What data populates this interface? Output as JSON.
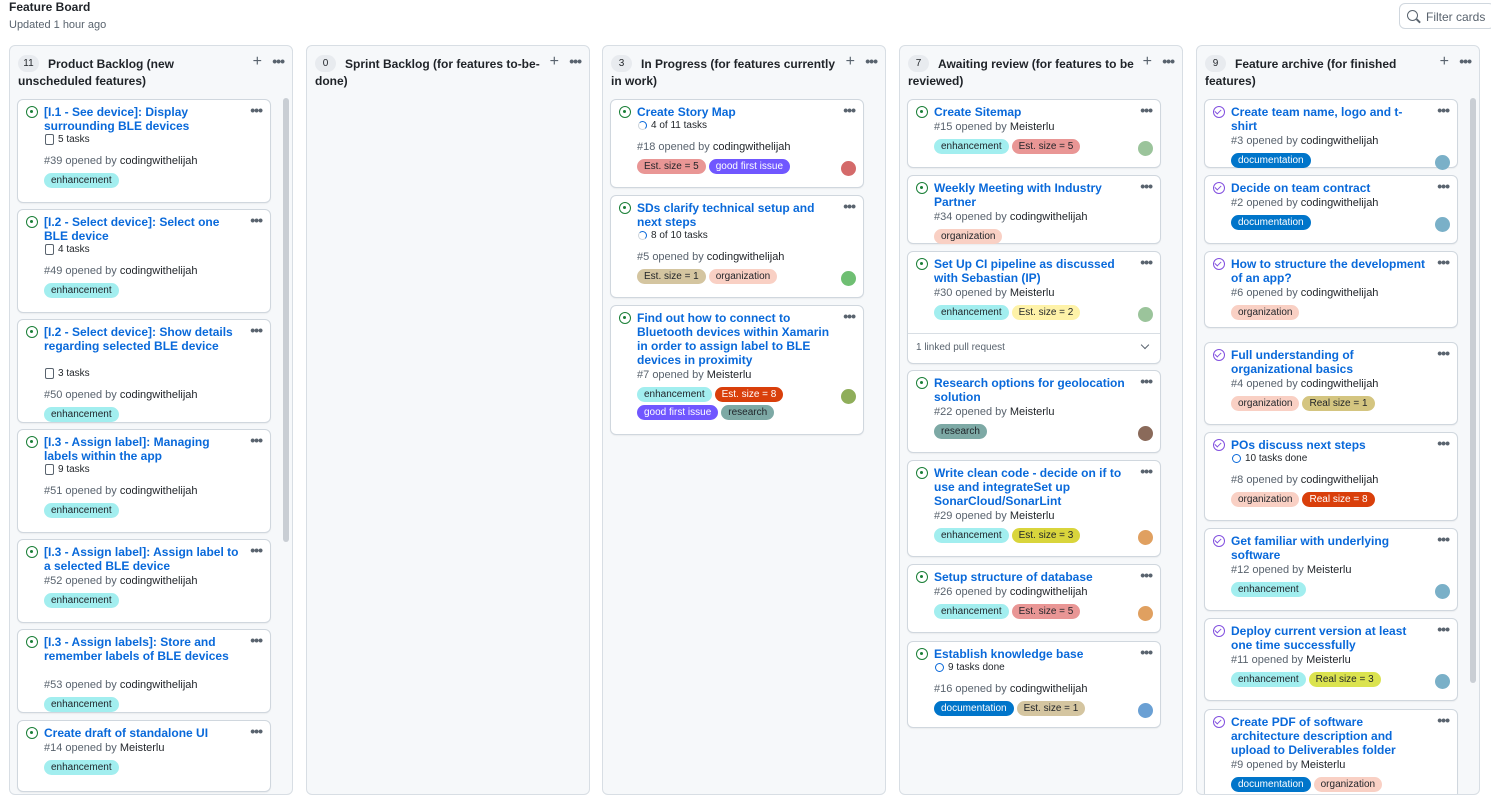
{
  "board": {
    "title": "Feature Board",
    "updated": "Updated 1 hour ago",
    "filter_placeholder": "Filter cards"
  },
  "label_colors": {
    "enhancement": "#a2eeef",
    "organization": "#f9d0c4",
    "documentation": "#0075ca",
    "research": "#7da9a5",
    "good first issue": "#7057ff",
    "Est. size = 5": "#e99695",
    "Est. size = 1": "#d4c5a0",
    "Est. size = 2": "#fef2a8",
    "Est. size = 3": "#d9d53c",
    "Est. size = 8": "#d93f0b",
    "Real size = 1": "#d4c580",
    "Real size = 3": "#dbe34f",
    "Real size = 8": "#d93f0b"
  },
  "columns": [
    {
      "count": "11",
      "title": "Product Backlog (new unscheduled features)",
      "cards": [
        {
          "title": "[I.1 - See device]: Display surrounding BLE devices",
          "tasks": "5 tasks",
          "task_icon": "checklist-icon",
          "num": "#39",
          "opened": "opened by",
          "author": "codingwithelijah",
          "labels": [
            "enhancement"
          ]
        },
        {
          "title": "[I.2 - Select device]: Select one BLE device",
          "tasks": "4 tasks",
          "task_icon": "checklist-icon",
          "num": "#49",
          "opened": "opened by",
          "author": "codingwithelijah",
          "labels": [
            "enhancement"
          ]
        },
        {
          "title": "[I.2 - Select device]: Show details regarding selected BLE device",
          "tasks": "3 tasks",
          "task_icon": "checklist-icon",
          "num": "#50",
          "opened": "opened by",
          "author": "codingwithelijah",
          "labels": [
            "enhancement"
          ]
        },
        {
          "title": "[I.3 - Assign label]: Managing labels within the app",
          "tasks": "9 tasks",
          "task_icon": "checklist-icon",
          "num": "#51",
          "opened": "opened by",
          "author": "codingwithelijah",
          "labels": [
            "enhancement"
          ]
        },
        {
          "title": "[I.3 - Assign label]: Assign label to a selected BLE device",
          "num": "#52",
          "opened": "opened by",
          "author": "codingwithelijah",
          "labels": [
            "enhancement"
          ]
        },
        {
          "title": "[I.3 - Assign labels]: Store and remember labels of BLE devices",
          "num": "#53",
          "opened": "opened by",
          "author": "codingwithelijah",
          "labels": [
            "enhancement"
          ]
        },
        {
          "title": "Create draft of standalone UI",
          "num": "#14",
          "opened": "opened by",
          "author": "Meisterlu",
          "labels": [
            "enhancement"
          ]
        }
      ]
    },
    {
      "count": "0",
      "title": "Sprint Backlog (for features to-be-done)",
      "cards": []
    },
    {
      "count": "3",
      "title": "In Progress (for features currently in work)",
      "cards": [
        {
          "title": "Create Story Map",
          "tasks": "4 of 11 tasks",
          "task_icon": "progress-icon",
          "num": "#18",
          "opened": "opened by",
          "author": "codingwithelijah",
          "labels": [
            "Est. size = 5",
            "good first issue"
          ],
          "avatar": "#d46a6a"
        },
        {
          "title": "SDs clarify technical setup and next steps",
          "tasks": "8 of 10 tasks",
          "task_icon": "progress-icon",
          "num": "#5",
          "opened": "opened by",
          "author": "codingwithelijah",
          "labels": [
            "Est. size = 1",
            "organization"
          ],
          "avatar": "#6fbf73"
        },
        {
          "title": "Find out how to connect to Bluetooth devices within Xamarin in order to assign label to BLE devices in proximity",
          "num": "#7",
          "opened": "opened by",
          "author": "Meisterlu",
          "labels": [
            "enhancement",
            "Est. size = 8",
            "good first issue",
            "research"
          ],
          "avatar": "#8fae5a"
        }
      ]
    },
    {
      "count": "7",
      "title": "Awaiting review (for features to be reviewed)",
      "cards": [
        {
          "title": "Create Sitemap",
          "num": "#15",
          "opened": "opened by",
          "author": "Meisterlu",
          "labels": [
            "enhancement",
            "Est. size = 5"
          ],
          "avatar": "#9bc49b"
        },
        {
          "title": "Weekly Meeting with Industry Partner",
          "num": "#34",
          "opened": "opened by",
          "author": "codingwithelijah",
          "labels": [
            "organization"
          ]
        },
        {
          "title": "Set Up CI pipeline as discussed with Sebastian (IP)",
          "num": "#30",
          "opened": "opened by",
          "author": "Meisterlu",
          "labels": [
            "enhancement",
            "Est. size = 2"
          ],
          "avatar": "#9bc49b",
          "linked_pr": "1 linked pull request"
        },
        {
          "title": "Research options for geolocation solution",
          "num": "#22",
          "opened": "opened by",
          "author": "Meisterlu",
          "labels": [
            "research"
          ],
          "avatar": "#8a6a5a"
        },
        {
          "title": "Write clean code - decide on if to use and integrateSet up SonarCloud/SonarLint",
          "num": "#29",
          "opened": "opened by",
          "author": "Meisterlu",
          "labels": [
            "enhancement",
            "Est. size = 3"
          ],
          "avatar": "#e0a060"
        },
        {
          "title": "Setup structure of database",
          "num": "#26",
          "opened": "opened by",
          "author": "codingwithelijah",
          "labels": [
            "enhancement",
            "Est. size = 5"
          ],
          "avatar": "#e0a060"
        },
        {
          "title": "Establish knowledge base",
          "tasks": "9 tasks done",
          "task_icon": "done-ring-icon",
          "num": "#16",
          "opened": "opened by",
          "author": "codingwithelijah",
          "labels": [
            "documentation",
            "Est. size = 1"
          ],
          "avatar": "#6aa0d4"
        }
      ]
    },
    {
      "count": "9",
      "title": "Feature archive (for finished features)",
      "cards": [
        {
          "title": "Create team name, logo and t-shirt",
          "num": "#3",
          "opened": "opened by",
          "author": "codingwithelijah",
          "labels": [
            "documentation"
          ],
          "closed": true,
          "avatar": "#7ab0c8"
        },
        {
          "title": "Decide on team contract",
          "num": "#2",
          "opened": "opened by",
          "author": "codingwithelijah",
          "labels": [
            "documentation"
          ],
          "closed": true,
          "avatar": "#7ab0c8"
        },
        {
          "title": "How to structure the development of an app?",
          "num": "#6",
          "opened": "opened by",
          "author": "codingwithelijah",
          "labels": [
            "organization"
          ],
          "closed": true
        },
        {
          "title": "Full understanding of organizational basics",
          "num": "#4",
          "opened": "opened by",
          "author": "codingwithelijah",
          "labels": [
            "organization",
            "Real size = 1"
          ],
          "closed": true
        },
        {
          "title": "POs discuss next steps",
          "tasks": "10 tasks done",
          "task_icon": "done-ring-icon",
          "num": "#8",
          "opened": "opened by",
          "author": "codingwithelijah",
          "labels": [
            "organization",
            "Real size = 8"
          ],
          "closed": true
        },
        {
          "title": "Get familiar with underlying software",
          "num": "#12",
          "opened": "opened by",
          "author": "Meisterlu",
          "labels": [
            "enhancement"
          ],
          "closed": true,
          "avatar": "#7ab0c8"
        },
        {
          "title": "Deploy current version at least one time successfully",
          "num": "#11",
          "opened": "opened by",
          "author": "Meisterlu",
          "labels": [
            "enhancement",
            "Real size = 3"
          ],
          "closed": true,
          "avatar": "#7ab0c8"
        },
        {
          "title": "Create PDF of software architecture description and upload to Deliverables folder",
          "num": "#9",
          "opened": "opened by",
          "author": "Meisterlu",
          "labels": [
            "documentation",
            "organization"
          ],
          "closed": true
        }
      ]
    }
  ]
}
